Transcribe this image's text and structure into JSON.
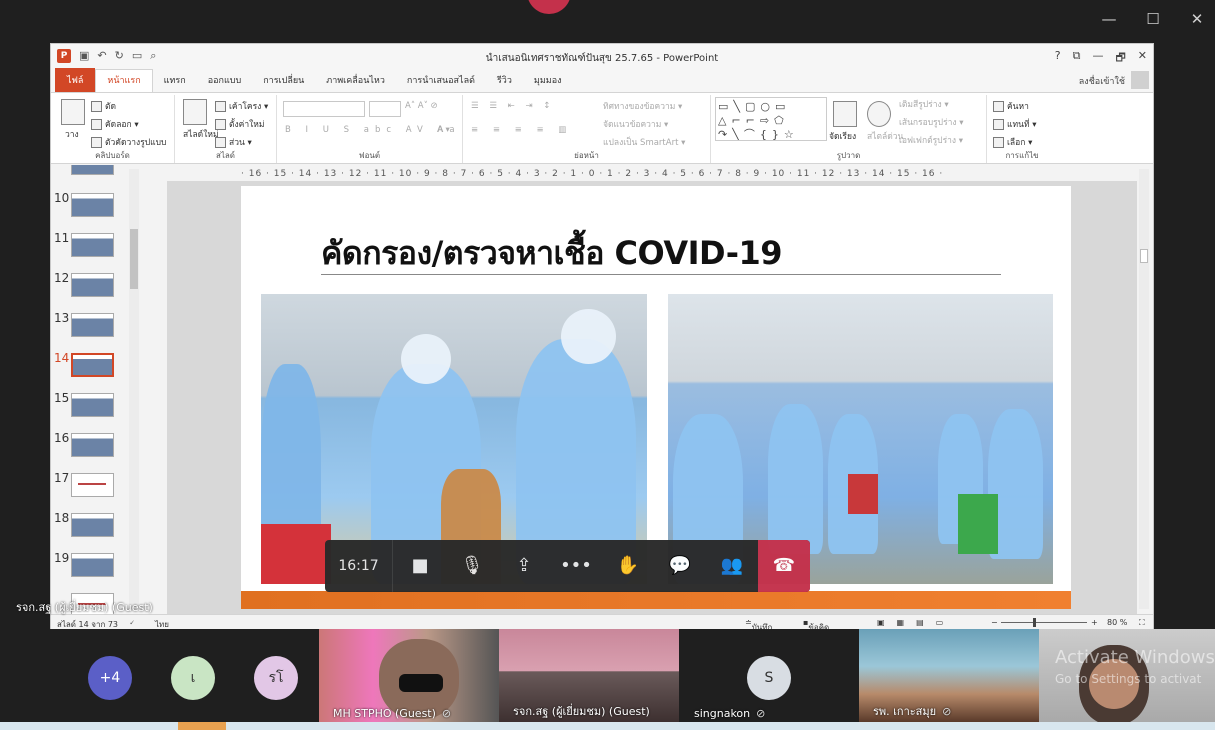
{
  "teams": {
    "window_controls": {
      "minimize": "—",
      "maximize": "☐",
      "close": "✕"
    },
    "meeting_time": "16:17",
    "presenter_label": "รจก.สฐ (ผู้เยี่ยมชม) (Guest)",
    "participants": [
      {
        "type": "count",
        "label": "+4",
        "color": "#5b5fc7"
      },
      {
        "type": "initial",
        "label": "เ",
        "color": "#c9e5c4"
      },
      {
        "type": "initial",
        "label": "รโ",
        "color": "#e2c7e6"
      },
      {
        "type": "video",
        "label": "MH STPHO (Guest)"
      },
      {
        "type": "video",
        "label": "รจก.สฐ (ผู้เยี่ยมชม) (Guest)"
      },
      {
        "type": "initial",
        "label": "S",
        "name": "singnakon",
        "color": "#d8dde3"
      },
      {
        "type": "video",
        "label": "รพ. เกาะสมุย"
      }
    ],
    "activate_windows": {
      "line1": "Activate Windows",
      "line2": "Go to Settings to activat"
    }
  },
  "ppt": {
    "title": "นำเสนอนิเทศราชทัณฑ์ปันสุข 25.7.65 - PowerPoint",
    "signin": "ลงชื่อเข้าใช้",
    "title_buttons": [
      "?",
      "⧉",
      "—",
      "🗗",
      "✕"
    ],
    "tabs": [
      "ไฟล์",
      "หน้าแรก",
      "แทรก",
      "ออกแบบ",
      "การเปลี่ยน",
      "ภาพเคลื่อนไหว",
      "การนำเสนอสไลด์",
      "รีวิว",
      "มุมมอง"
    ],
    "ribbon": {
      "clipboard": {
        "label": "คลิปบอร์ด",
        "paste": "วาง",
        "cut": "ตัด",
        "copy": "คัดลอก",
        "format_painter": "ตัวคัดวางรูปแบบ"
      },
      "slides": {
        "label": "สไลด์",
        "new_slide": "สไลด์ใหม่",
        "layout": "เค้าโครง",
        "reset": "ตั้งค่าใหม่",
        "section": "ส่วน"
      },
      "font": {
        "label": "ฟอนต์"
      },
      "paragraph": {
        "label": "ย่อหน้า",
        "text_direction": "ทิศทางของข้อความ",
        "align_text": "จัดแนวข้อความ",
        "smartart": "แปลงเป็น SmartArt"
      },
      "drawing": {
        "label": "รูปวาด",
        "arrange": "จัดเรียง",
        "quick_styles": "สไตล์ด่วน",
        "fill": "เติมสีรูปร่าง",
        "outline": "เส้นกรอบรูปร่าง",
        "effects": "เอฟเฟกต์รูปร่าง"
      },
      "editing": {
        "label": "การแก้ไข",
        "find": "ค้นหา",
        "replace": "แทนที่",
        "select": "เลือก"
      }
    },
    "slide_numbers": [
      "10",
      "11",
      "12",
      "13",
      "14",
      "15",
      "16",
      "17",
      "18",
      "19"
    ],
    "current_slide": "14",
    "ruler_text": "· 16 · 15 · 14 · 13 · 12 · 11 · 10 · 9 · 8 · 7 · 6 · 5 · 4 · 3 · 2 · 1 · 0 · 1 · 2 · 3 · 4 · 5 · 6 · 7 · 8 · 9 · 10 · 11 · 12 · 13 · 14 · 15 · 16 ·",
    "slide_title": "คัดกรอง/ตรวจหาเชื้อ COVID-19",
    "status": {
      "slide_of": "สไลด์ 14 จาก 73",
      "language": "ไทย",
      "notes": "บันทึกย่อ",
      "comments": "ข้อคิดเห็น",
      "zoom": "80 %"
    }
  }
}
